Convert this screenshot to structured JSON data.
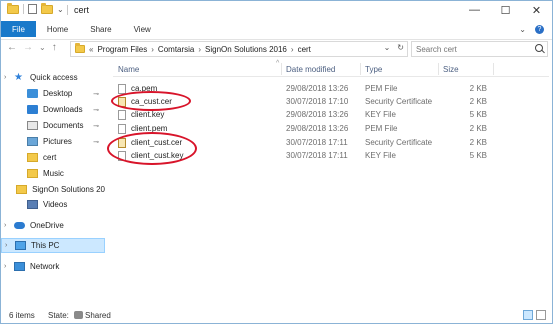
{
  "window": {
    "title": "cert",
    "controls": {
      "minimize": "—",
      "maximize": "☐",
      "close": "✕"
    }
  },
  "ribbon": {
    "tabs": [
      "File",
      "Home",
      "Share",
      "View"
    ],
    "expand_glyph": "⌄",
    "help_glyph": "?"
  },
  "navigation": {
    "back": "←",
    "forward": "→",
    "recent": "⌄",
    "up": "↑"
  },
  "address": {
    "lead_glyph": "«",
    "crumbs": [
      "Program Files",
      "Comtarsia",
      "SignOn Solutions 2016",
      "cert"
    ],
    "separator": "›",
    "dropdown": "⌄",
    "refresh": "↻"
  },
  "search": {
    "placeholder": "Search cert"
  },
  "sidebar": {
    "items": [
      {
        "label": "Quick access",
        "icon": "star-icon"
      },
      {
        "label": "Desktop",
        "icon": "desktop-icon",
        "pin": "📌"
      },
      {
        "label": "Downloads",
        "icon": "downloads-icon",
        "pin": "📌"
      },
      {
        "label": "Documents",
        "icon": "documents-icon",
        "pin": "📌"
      },
      {
        "label": "Pictures",
        "icon": "pictures-icon",
        "pin": "📌"
      },
      {
        "label": "cert",
        "icon": "folder-icon"
      },
      {
        "label": "Music",
        "icon": "music-icon"
      },
      {
        "label": "SignOn Solutions 20",
        "icon": "folder-icon"
      },
      {
        "label": "Videos",
        "icon": "videos-icon"
      },
      {
        "label": "OneDrive",
        "icon": "onedrive-icon"
      },
      {
        "label": "This PC",
        "icon": "pc-icon"
      },
      {
        "label": "Network",
        "icon": "network-icon"
      }
    ],
    "expanders": {
      "quick_access": "›",
      "onedrive": "›",
      "this_pc": "›",
      "network": "›"
    }
  },
  "columns": {
    "name": "Name",
    "date": "Date modified",
    "type": "Type",
    "size": "Size",
    "sort_glyph": "^"
  },
  "files": [
    {
      "name": "ca.pem",
      "date": "29/08/2018 13:26",
      "type": "PEM File",
      "size": "2 KB",
      "icon": "file-icon",
      "circled": false
    },
    {
      "name": "ca_cust.cer",
      "date": "30/07/2018 17:10",
      "type": "Security Certificate",
      "size": "2 KB",
      "icon": "certificate-icon",
      "circled": true
    },
    {
      "name": "client.key",
      "date": "29/08/2018 13:26",
      "type": "KEY File",
      "size": "5 KB",
      "icon": "file-icon",
      "circled": false
    },
    {
      "name": "client.pem",
      "date": "29/08/2018 13:26",
      "type": "PEM File",
      "size": "2 KB",
      "icon": "file-icon",
      "circled": false
    },
    {
      "name": "client_cust.cer",
      "date": "30/07/2018 17:11",
      "type": "Security Certificate",
      "size": "2 KB",
      "icon": "certificate-icon",
      "circled": true
    },
    {
      "name": "client_cust.key",
      "date": "30/07/2018 17:11",
      "type": "KEY File",
      "size": "5 KB",
      "icon": "file-icon",
      "circled": true
    }
  ],
  "status": {
    "items": "6 items",
    "state_label": "State:",
    "state_value": "Shared"
  },
  "colors": {
    "accent": "#1979ca",
    "selection": "#cce8ff",
    "annotation": "#d8142a"
  }
}
